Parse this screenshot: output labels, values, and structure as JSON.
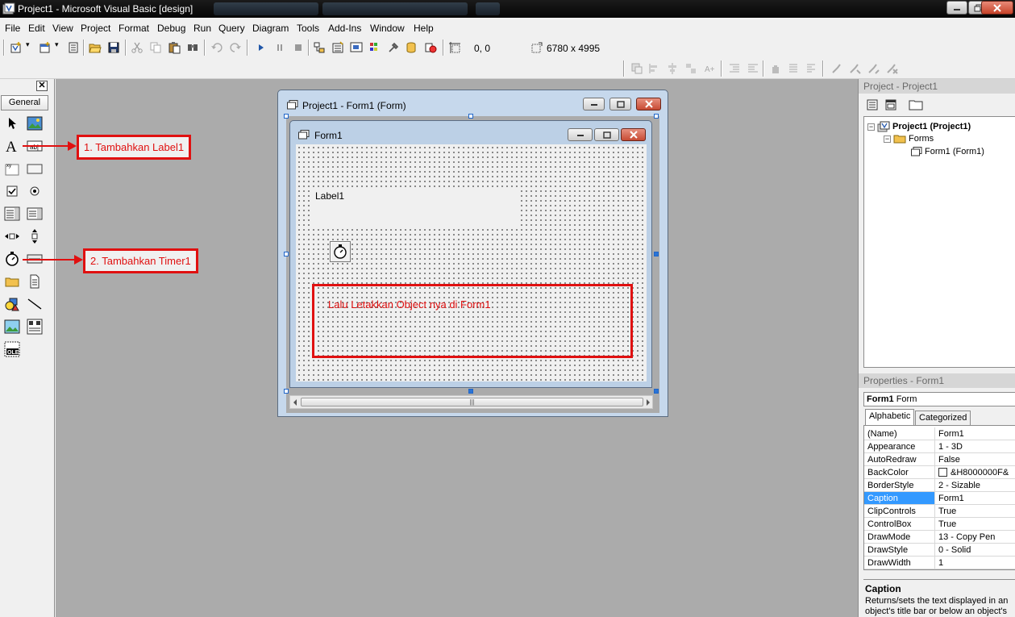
{
  "window": {
    "title": "Project1 - Microsoft Visual Basic [design]"
  },
  "menu": [
    "File",
    "Edit",
    "View",
    "Project",
    "Format",
    "Debug",
    "Run",
    "Query",
    "Diagram",
    "Tools",
    "Add-Ins",
    "Window",
    "Help"
  ],
  "toolbar": {
    "position_readout": "0, 0",
    "size_readout": "6780 x 4995"
  },
  "toolbox": {
    "tab_label": "General",
    "tools": [
      "pointer-icon",
      "picturebox-icon",
      "label-icon",
      "textbox-icon",
      "frame-icon",
      "commandbutton-icon",
      "checkbox-icon",
      "optionbutton-icon",
      "combobox-icon",
      "listbox-icon",
      "hscrollbar-icon",
      "vscrollbar-icon",
      "timer-icon",
      "drivelistbox-icon",
      "dirlistbox-icon",
      "filelistbox-icon",
      "shape-icon",
      "line-icon",
      "image-icon",
      "data-icon",
      "ole-icon"
    ]
  },
  "designer": {
    "title": "Project1 - Form1 (Form)",
    "form_caption": "Form1",
    "label_caption": "Label1",
    "instruction_note": "Lalu Letakkan Object nya di Form1"
  },
  "annotations": {
    "step1": "1. Tambahkan Label1",
    "step2": "2. Tambahkan Timer1"
  },
  "project_explorer": {
    "title": "Project - Project1",
    "root": "Project1 (Project1)",
    "folder": "Forms",
    "item": "Form1 (Form1)"
  },
  "properties": {
    "title": "Properties - Form1",
    "object_name": "Form1",
    "object_type": "Form",
    "tab_alphabetic": "Alphabetic",
    "tab_categorized": "Categorized",
    "rows": [
      {
        "name": "(Name)",
        "value": "Form1"
      },
      {
        "name": "Appearance",
        "value": "1 - 3D"
      },
      {
        "name": "AutoRedraw",
        "value": "False"
      },
      {
        "name": "BackColor",
        "value": "&H8000000F&"
      },
      {
        "name": "BorderStyle",
        "value": "2 - Sizable"
      },
      {
        "name": "Caption",
        "value": "Form1"
      },
      {
        "name": "ClipControls",
        "value": "True"
      },
      {
        "name": "ControlBox",
        "value": "True"
      },
      {
        "name": "DrawMode",
        "value": "13 - Copy Pen"
      },
      {
        "name": "DrawStyle",
        "value": "0 - Solid"
      },
      {
        "name": "DrawWidth",
        "value": "1"
      }
    ],
    "selected_row": "Caption",
    "description_title": "Caption",
    "description_text": "Returns/sets the text displayed in an object's title bar or below an object's ic"
  },
  "colors": {
    "annotation_red": "#e01010",
    "selection_blue": "#3399ff",
    "mdi_gray": "#ababab"
  }
}
